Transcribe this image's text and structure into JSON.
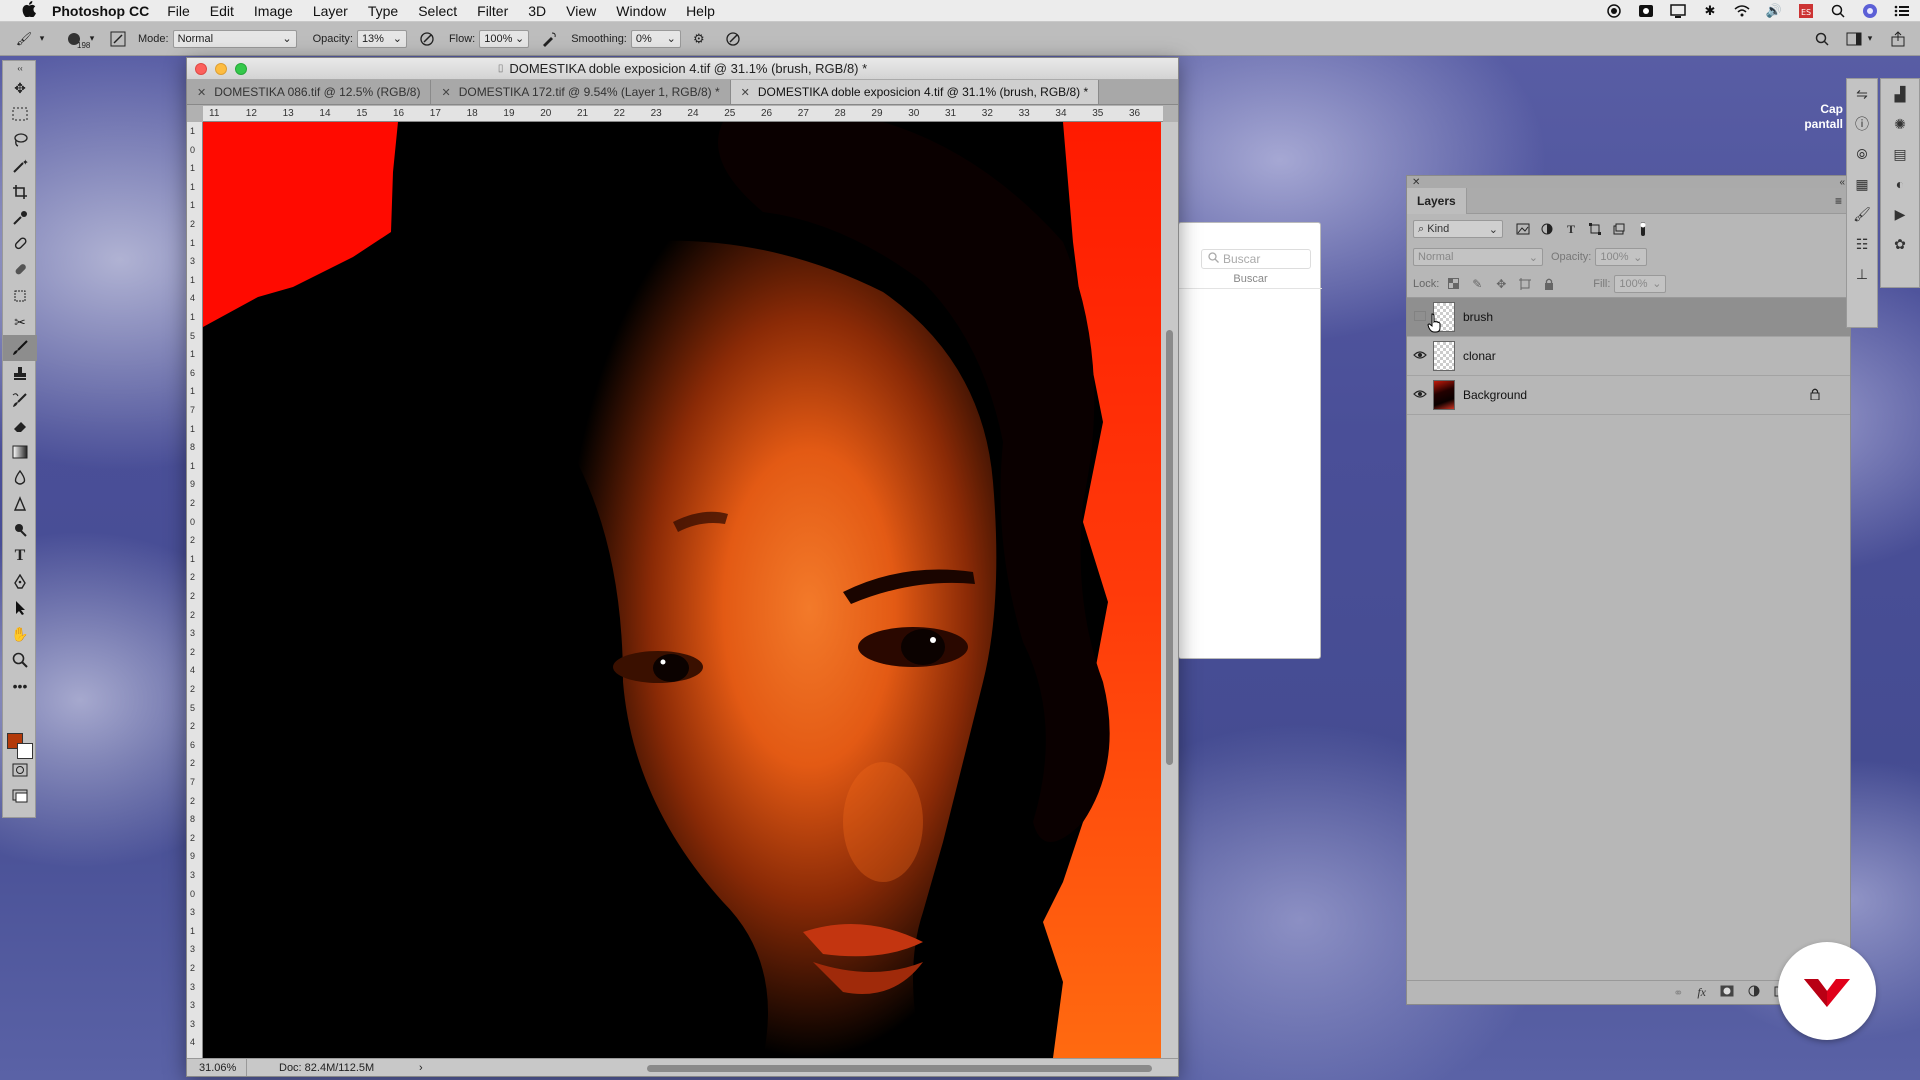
{
  "menubar": {
    "app_name": "Photoshop CC",
    "items": [
      "File",
      "Edit",
      "Image",
      "Layer",
      "Type",
      "Select",
      "Filter",
      "3D",
      "View",
      "Window",
      "Help"
    ]
  },
  "options": {
    "brush_size": "198",
    "mode_label": "Mode:",
    "mode_value": "Normal",
    "opacity_label": "Opacity:",
    "opacity_value": "13%",
    "flow_label": "Flow:",
    "flow_value": "100%",
    "smoothing_label": "Smoothing:",
    "smoothing_value": "0%"
  },
  "document": {
    "title": "DOMESTIKA doble exposicion 4.tif @ 31.1% (brush, RGB/8) *",
    "tabs": [
      {
        "label": "DOMESTIKA 086.tif @ 12.5% (RGB/8)",
        "active": false
      },
      {
        "label": "DOMESTIKA 172.tif @ 9.54% (Layer 1, RGB/8) *",
        "active": false
      },
      {
        "label": "DOMESTIKA doble exposicion 4.tif @ 31.1% (brush, RGB/8) *",
        "active": true
      }
    ],
    "ruler_top": [
      "11",
      "12",
      "13",
      "14",
      "15",
      "16",
      "17",
      "18",
      "19",
      "20",
      "21",
      "22",
      "23",
      "24",
      "25",
      "26",
      "27",
      "28",
      "29",
      "30",
      "31",
      "32",
      "33",
      "34",
      "35",
      "36"
    ],
    "ruler_left": [
      "1",
      "0",
      "1",
      "1",
      "1",
      "2",
      "1",
      "3",
      "1",
      "4",
      "1",
      "5",
      "1",
      "6",
      "1",
      "7",
      "1",
      "8",
      "1",
      "9",
      "2",
      "0",
      "2",
      "1",
      "2",
      "2",
      "2",
      "3",
      "2",
      "4",
      "2",
      "5",
      "2",
      "6",
      "2",
      "7",
      "2",
      "8",
      "2",
      "9",
      "3",
      "0",
      "3",
      "1",
      "3",
      "2",
      "3",
      "3",
      "3",
      "4"
    ],
    "zoom": "31.06%",
    "doc_size": "Doc: 82.4M/112.5M"
  },
  "search": {
    "placeholder": "Buscar",
    "label": "Buscar"
  },
  "layers_panel": {
    "tab_label": "Layers",
    "kind_label": "Kind",
    "blend_mode": "Normal",
    "opacity_label": "Opacity:",
    "opacity_value": "100%",
    "lock_label": "Lock:",
    "fill_label": "Fill:",
    "fill_value": "100%",
    "layers": [
      {
        "name": "brush",
        "visible": false,
        "selected": true,
        "locked": false
      },
      {
        "name": "clonar",
        "visible": true,
        "selected": false,
        "locked": false
      },
      {
        "name": "Background",
        "visible": true,
        "selected": false,
        "locked": true
      }
    ]
  },
  "overlay": {
    "cap_line1": "Cap",
    "cap_line2": "pantall"
  },
  "colors": {
    "foreground": "#b33a0a",
    "background": "#ffffff",
    "accent_red": "#e0001a"
  }
}
